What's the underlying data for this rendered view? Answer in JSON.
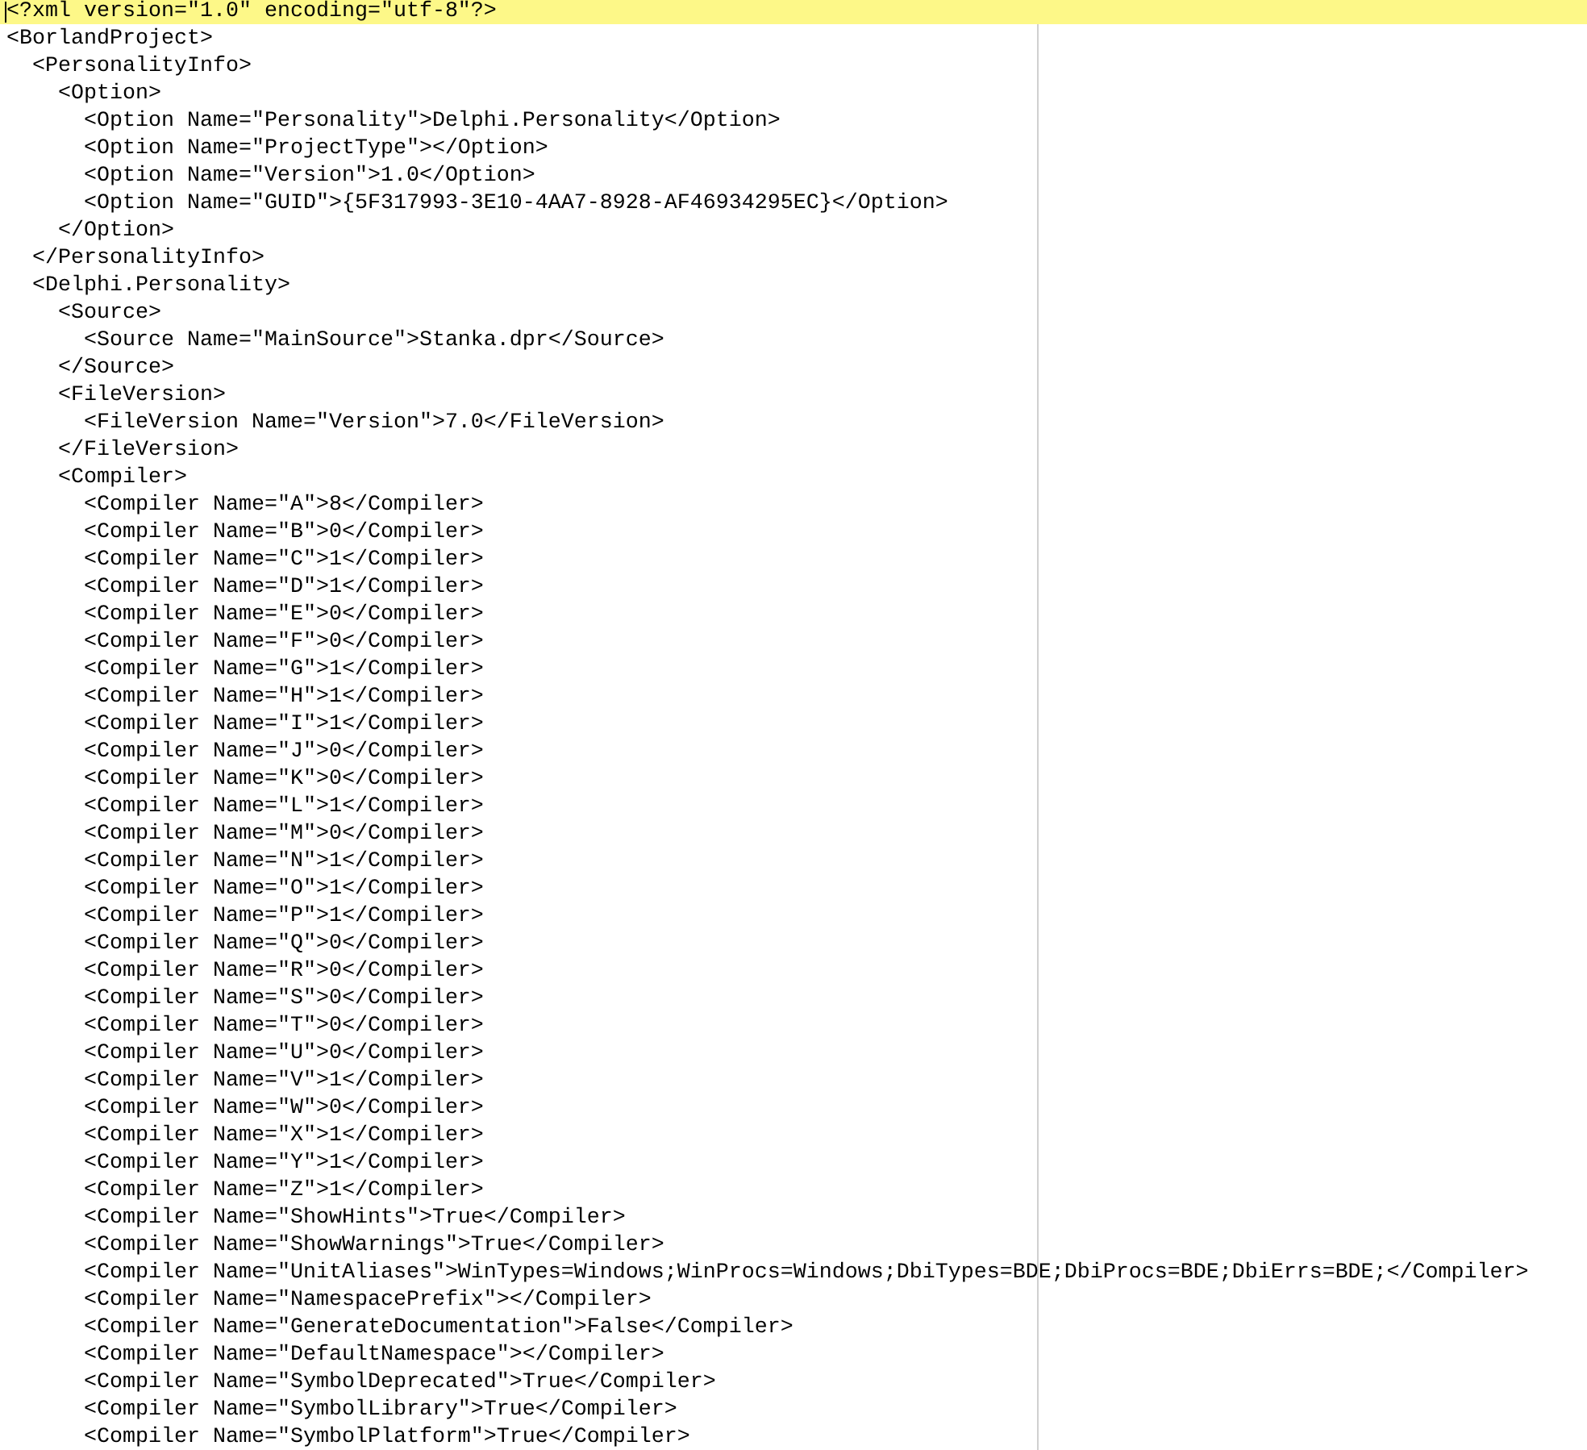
{
  "editor": {
    "lines": [
      {
        "text": "<?xml version=\"1.0\" encoding=\"utf-8\"?>",
        "selected": true
      },
      {
        "text": "<BorlandProject>",
        "selected": false
      },
      {
        "text": "  <PersonalityInfo>",
        "selected": false
      },
      {
        "text": "    <Option>",
        "selected": false
      },
      {
        "text": "      <Option Name=\"Personality\">Delphi.Personality</Option>",
        "selected": false
      },
      {
        "text": "      <Option Name=\"ProjectType\"></Option>",
        "selected": false
      },
      {
        "text": "      <Option Name=\"Version\">1.0</Option>",
        "selected": false
      },
      {
        "text": "      <Option Name=\"GUID\">{5F317993-3E10-4AA7-8928-AF46934295EC}</Option>",
        "selected": false
      },
      {
        "text": "    </Option>",
        "selected": false
      },
      {
        "text": "  </PersonalityInfo>",
        "selected": false
      },
      {
        "text": "  <Delphi.Personality>",
        "selected": false
      },
      {
        "text": "    <Source>",
        "selected": false
      },
      {
        "text": "      <Source Name=\"MainSource\">Stanka.dpr</Source>",
        "selected": false
      },
      {
        "text": "    </Source>",
        "selected": false
      },
      {
        "text": "    <FileVersion>",
        "selected": false
      },
      {
        "text": "      <FileVersion Name=\"Version\">7.0</FileVersion>",
        "selected": false
      },
      {
        "text": "    </FileVersion>",
        "selected": false
      },
      {
        "text": "    <Compiler>",
        "selected": false
      },
      {
        "text": "      <Compiler Name=\"A\">8</Compiler>",
        "selected": false
      },
      {
        "text": "      <Compiler Name=\"B\">0</Compiler>",
        "selected": false
      },
      {
        "text": "      <Compiler Name=\"C\">1</Compiler>",
        "selected": false
      },
      {
        "text": "      <Compiler Name=\"D\">1</Compiler>",
        "selected": false
      },
      {
        "text": "      <Compiler Name=\"E\">0</Compiler>",
        "selected": false
      },
      {
        "text": "      <Compiler Name=\"F\">0</Compiler>",
        "selected": false
      },
      {
        "text": "      <Compiler Name=\"G\">1</Compiler>",
        "selected": false
      },
      {
        "text": "      <Compiler Name=\"H\">1</Compiler>",
        "selected": false
      },
      {
        "text": "      <Compiler Name=\"I\">1</Compiler>",
        "selected": false
      },
      {
        "text": "      <Compiler Name=\"J\">0</Compiler>",
        "selected": false
      },
      {
        "text": "      <Compiler Name=\"K\">0</Compiler>",
        "selected": false
      },
      {
        "text": "      <Compiler Name=\"L\">1</Compiler>",
        "selected": false
      },
      {
        "text": "      <Compiler Name=\"M\">0</Compiler>",
        "selected": false
      },
      {
        "text": "      <Compiler Name=\"N\">1</Compiler>",
        "selected": false
      },
      {
        "text": "      <Compiler Name=\"O\">1</Compiler>",
        "selected": false
      },
      {
        "text": "      <Compiler Name=\"P\">1</Compiler>",
        "selected": false
      },
      {
        "text": "      <Compiler Name=\"Q\">0</Compiler>",
        "selected": false
      },
      {
        "text": "      <Compiler Name=\"R\">0</Compiler>",
        "selected": false
      },
      {
        "text": "      <Compiler Name=\"S\">0</Compiler>",
        "selected": false
      },
      {
        "text": "      <Compiler Name=\"T\">0</Compiler>",
        "selected": false
      },
      {
        "text": "      <Compiler Name=\"U\">0</Compiler>",
        "selected": false
      },
      {
        "text": "      <Compiler Name=\"V\">1</Compiler>",
        "selected": false
      },
      {
        "text": "      <Compiler Name=\"W\">0</Compiler>",
        "selected": false
      },
      {
        "text": "      <Compiler Name=\"X\">1</Compiler>",
        "selected": false
      },
      {
        "text": "      <Compiler Name=\"Y\">1</Compiler>",
        "selected": false
      },
      {
        "text": "      <Compiler Name=\"Z\">1</Compiler>",
        "selected": false
      },
      {
        "text": "      <Compiler Name=\"ShowHints\">True</Compiler>",
        "selected": false
      },
      {
        "text": "      <Compiler Name=\"ShowWarnings\">True</Compiler>",
        "selected": false
      },
      {
        "text": "      <Compiler Name=\"UnitAliases\">WinTypes=Windows;WinProcs=Windows;DbiTypes=BDE;DbiProcs=BDE;DbiErrs=BDE;</Compiler>",
        "selected": false
      },
      {
        "text": "      <Compiler Name=\"NamespacePrefix\"></Compiler>",
        "selected": false
      },
      {
        "text": "      <Compiler Name=\"GenerateDocumentation\">False</Compiler>",
        "selected": false
      },
      {
        "text": "      <Compiler Name=\"DefaultNamespace\"></Compiler>",
        "selected": false
      },
      {
        "text": "      <Compiler Name=\"SymbolDeprecated\">True</Compiler>",
        "selected": false
      },
      {
        "text": "      <Compiler Name=\"SymbolLibrary\">True</Compiler>",
        "selected": false
      },
      {
        "text": "      <Compiler Name=\"SymbolPlatform\">True</Compiler>",
        "selected": false
      }
    ]
  }
}
